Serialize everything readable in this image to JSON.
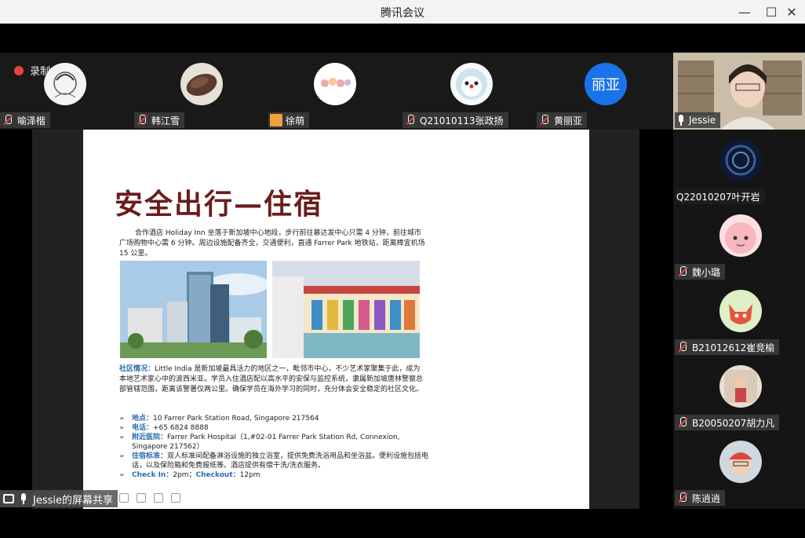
{
  "window": {
    "title": "腾讯会议",
    "minimize": "—",
    "maximize": "☐",
    "close": "✕"
  },
  "recording": {
    "label": "录制中"
  },
  "participants_top": [
    {
      "name": "喻泽楷"
    },
    {
      "name": "韩江雪"
    },
    {
      "name": "徐萌"
    },
    {
      "name": "Q21010113张政扬"
    },
    {
      "name": "黄丽亚",
      "avatar_text": "丽亚"
    }
  ],
  "host": {
    "name": "Jessie"
  },
  "participants_side": [
    {
      "name": "Q22010207叶开岩"
    },
    {
      "name": "魏小璐"
    },
    {
      "name": "B21012612崔竞榆"
    },
    {
      "name": "B20050207胡力凡"
    },
    {
      "name": "陈逍逍"
    }
  ],
  "slide": {
    "title": "安全出行—住宿",
    "intro": "合作酒店 Holiday Inn 坐落于新加坡中心地段，步行前往慕达发中心只需 4 分钟，前往城市广场购物中心需 6 分钟。周边设施配备齐全，交通便利，直通 Farrer Park 地铁站，距离樟宜机场 15 公里。",
    "area_label": "社区情况：",
    "area_text": "Little India 是新加坡最具活力的地区之一，毗邻市中心，不少艺术家聚集于此，成为本地艺术家心中的波西米亚。学员入住酒店配以高水平的安保与监控系统，隶属新加坡唐林警察总部管辖范围，距离该警署仅两公里。确保学员在海外学习的同时，充分体会安全稳定的社区文化。",
    "bullets": [
      {
        "label": "地点：",
        "text": "10 Farrer Park Station Road, Singapore 217564"
      },
      {
        "label": "电话：",
        "text": "+65 6824 8888"
      },
      {
        "label": "附近医院：",
        "text": "Farrer Park Hospital（1,#02-01 Farrer Park Station Rd, Connexion, Singapore 217562）"
      },
      {
        "label": "住宿标准：",
        "text": "双人标准间配备淋浴设施的独立浴室，提供免费洗浴用品和坐浴盆。便利设施包括电话，以及保险箱和免费报纸等。酒店提供有偿干洗/洗衣服务。"
      }
    ],
    "checkin_label": "Check In：",
    "checkin_value": "2pm；",
    "checkout_label": "Checkout：",
    "checkout_value": "12pm"
  },
  "share": {
    "label": "Jessie的屏幕共享"
  },
  "colors": {
    "accent_red": "#e0463f",
    "title_red": "#6b1c1c",
    "label_blue": "#2b6cb0"
  }
}
